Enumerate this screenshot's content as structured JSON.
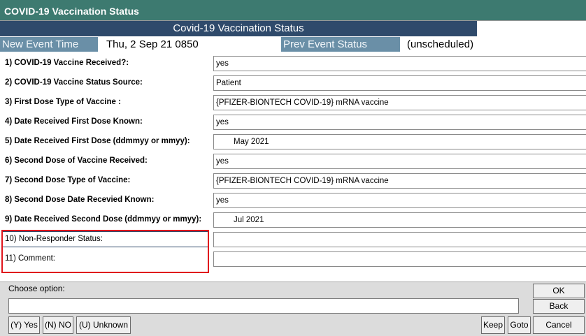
{
  "window": {
    "title": "COVID-19 Vaccination Status"
  },
  "form": {
    "section_title": "Covid-19 Vaccination Status",
    "new_event_time_label": "New Event Time",
    "new_event_time_value": "Thu, 2 Sep 21  0850",
    "prev_event_status_label": "Prev Event Status",
    "prev_event_status_value": "(unscheduled)"
  },
  "questions": [
    {
      "label": "1)  COVID-19 Vaccine Received?:",
      "value": "yes"
    },
    {
      "label": "2)  COVID-19 Vaccine Status Source:",
      "value": "Patient"
    },
    {
      "label": "3)  First Dose Type of Vaccine :",
      "value": "{PFIZER-BIONTECH COVID-19} mRNA vaccine"
    },
    {
      "label": "4)  Date Received First Dose Known:",
      "value": "yes"
    },
    {
      "label": "5)  Date Received First Dose (ddmmyy or mmyy):",
      "value": "May 2021"
    },
    {
      "label": "6)  Second Dose of Vaccine Received:",
      "value": "yes"
    },
    {
      "label": "7)  Second Dose Type of Vaccine:",
      "value": "{PFIZER-BIONTECH COVID-19} mRNA vaccine"
    },
    {
      "label": "8)  Second Dose Date Recevied Known:",
      "value": "yes"
    },
    {
      "label": "9)  Date Received Second Dose (ddmmyy or mmyy):",
      "value": "Jul 2021"
    },
    {
      "label": "10)  Non-Responder Status:",
      "value": ""
    },
    {
      "label": "11)  Comment:",
      "value": ""
    }
  ],
  "bottom": {
    "choose_label": "Choose option:",
    "choose_value": "",
    "yes_label": "(Y) Yes",
    "no_label": "(N) NO",
    "unknown_label": "(U) Unknown",
    "keep_label": "Keep",
    "goto_label": "Goto",
    "ok_label": "OK",
    "back_label": "Back",
    "cancel_label": "Cancel"
  },
  "colors": {
    "titlebar": "#3d7a70",
    "section_header": "#2f4a6b",
    "field_label_bg": "#6a8fa7",
    "highlight": "#e0141c"
  }
}
